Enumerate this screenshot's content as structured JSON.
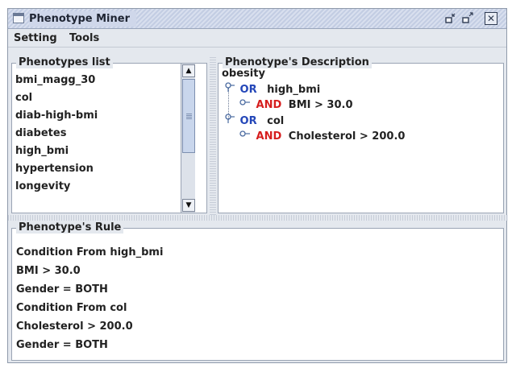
{
  "window": {
    "title": "Phenotype Miner",
    "title_buttons": {
      "minimize": "▫",
      "maximize": "▫",
      "close": "✕"
    }
  },
  "menubar": {
    "items": [
      {
        "label": "Setting"
      },
      {
        "label": "Tools"
      }
    ]
  },
  "phenotypes_list": {
    "title": "Phenotypes list",
    "items": [
      "bmi_magg_30",
      "col",
      "diab-high-bmi",
      "diabetes",
      "high_bmi",
      "hypertension",
      "longevity"
    ],
    "scrollbar": {
      "up_glyph": "▲",
      "down_glyph": "▼"
    }
  },
  "description": {
    "title": "Phenotype's Description",
    "root": "obesity",
    "tree": [
      {
        "operator": "OR",
        "text": "high_bmi",
        "children": [
          {
            "operator": "AND",
            "text": "BMI > 30.0"
          }
        ]
      },
      {
        "operator": "OR",
        "text": "col",
        "children": [
          {
            "operator": "AND",
            "text": "Cholesterol > 200.0"
          }
        ]
      }
    ],
    "handles": {
      "expanded": "⚲",
      "leaf": "⊸"
    }
  },
  "rule": {
    "title": "Phenotype's Rule",
    "lines": [
      "Condition From high_bmi",
      "BMI > 30.0",
      "Gender = BOTH",
      "Condition From col",
      "Cholesterol > 200.0",
      "Gender = BOTH"
    ]
  },
  "colors": {
    "or_operator": "#2346b8",
    "and_operator": "#d61e1e",
    "titlebar": "#c3cde3",
    "window_bg": "#e4e8ee"
  }
}
